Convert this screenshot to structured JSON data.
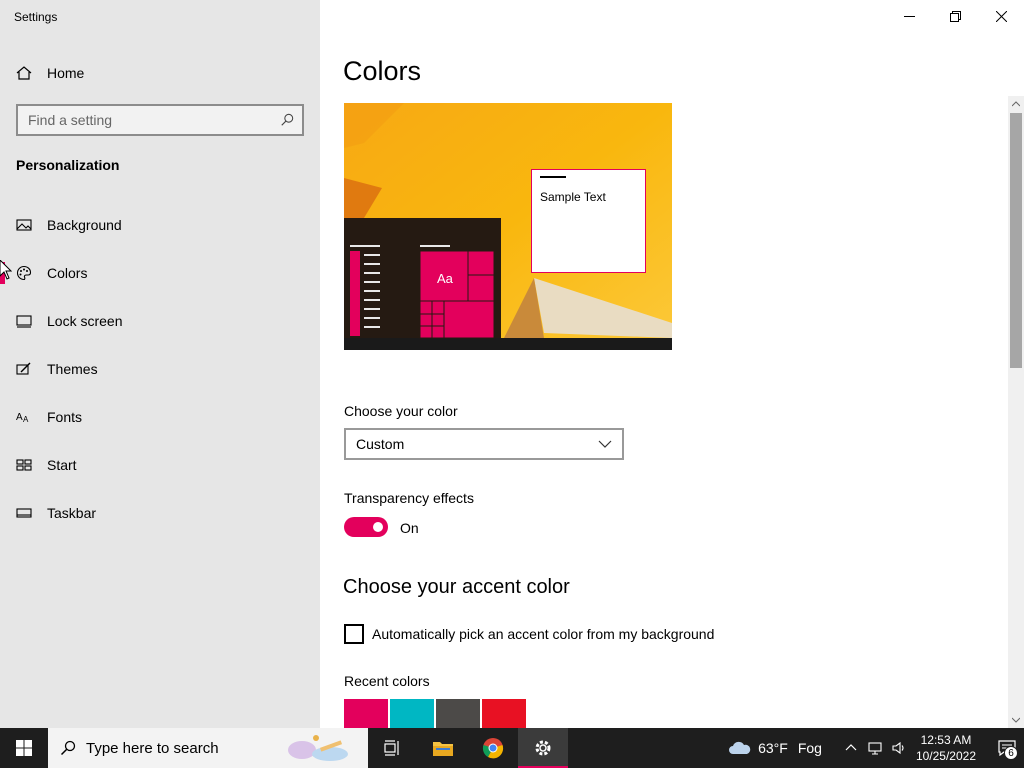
{
  "app": {
    "title": "Settings"
  },
  "sidebar": {
    "home_label": "Home",
    "search_placeholder": "Find a setting",
    "section_title": "Personalization",
    "items": [
      {
        "label": "Background",
        "icon": "picture-icon"
      },
      {
        "label": "Colors",
        "icon": "palette-icon",
        "active": true
      },
      {
        "label": "Lock screen",
        "icon": "lock-screen-icon"
      },
      {
        "label": "Themes",
        "icon": "brush-icon"
      },
      {
        "label": "Fonts",
        "icon": "font-icon"
      },
      {
        "label": "Start",
        "icon": "start-layout-icon"
      },
      {
        "label": "Taskbar",
        "icon": "taskbar-icon"
      }
    ]
  },
  "main": {
    "title": "Colors",
    "preview": {
      "sample_text": "Sample Text",
      "tile_text": "Aa"
    },
    "choose_color_label": "Choose your color",
    "choose_color_value": "Custom",
    "transparency_label": "Transparency effects",
    "transparency_state": "On",
    "accent_heading": "Choose your accent color",
    "auto_accent_label": "Automatically pick an accent color from my background",
    "auto_accent_checked": false,
    "recent_colors_label": "Recent colors",
    "recent_colors": [
      "#e3005c",
      "#00b7c3",
      "#4c4a48",
      "#e81123"
    ]
  },
  "taskbar": {
    "search_placeholder": "Type here to search",
    "weather_temp": "63°F",
    "weather_desc": "Fog",
    "time": "12:53 AM",
    "date": "10/25/2022",
    "notification_count": "6"
  },
  "colors": {
    "accent": "#e3005c",
    "sidebar_bg": "#e6e6e6",
    "taskbar_bg": "#1e1e1e"
  }
}
